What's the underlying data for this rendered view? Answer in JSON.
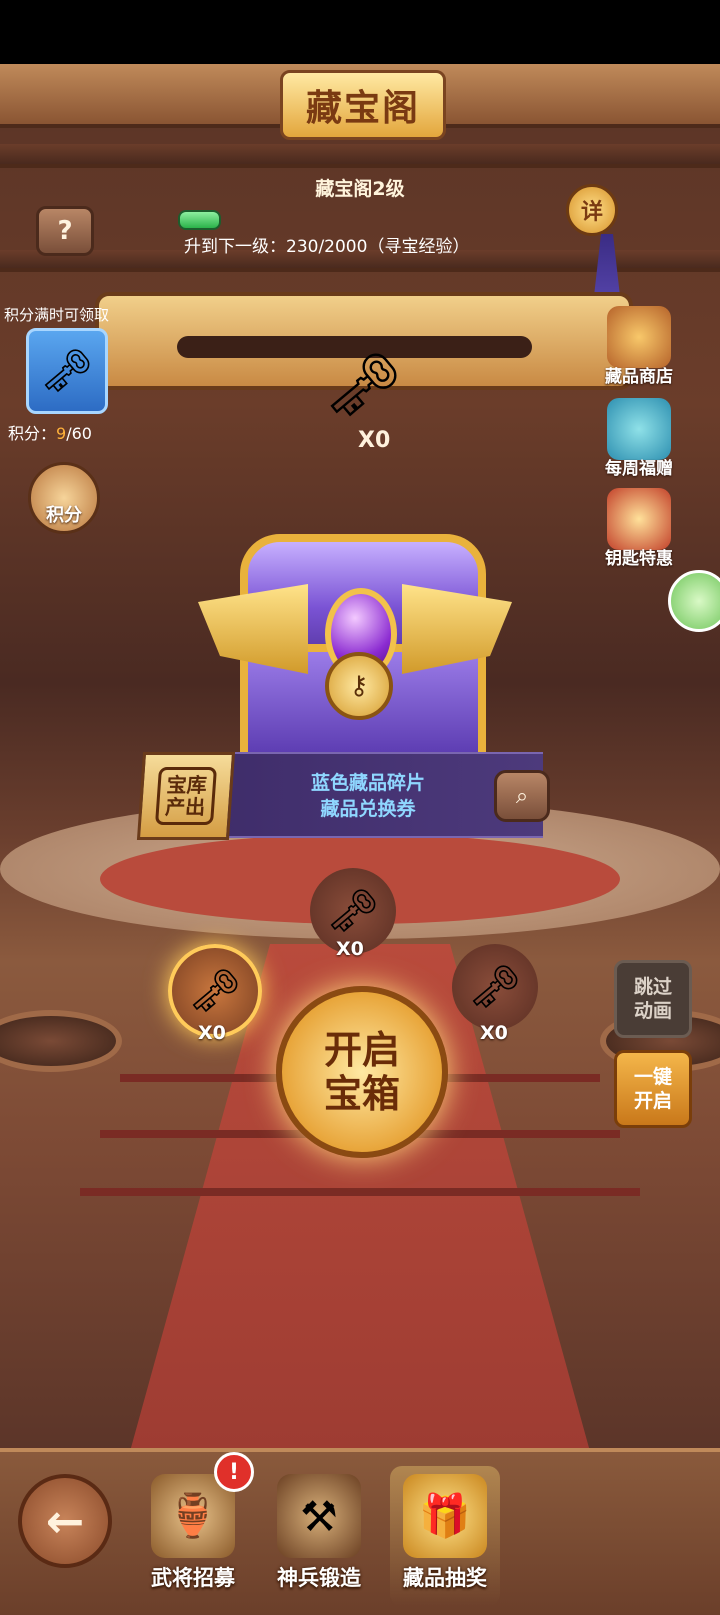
{
  "header": {
    "title": "藏宝阁",
    "level": "藏宝阁2级",
    "exp_progress": 0.115,
    "exp_text": "升到下一级：230/2000（寻宝经验）",
    "help_label": "?",
    "detail_label": "详"
  },
  "points": {
    "claim_hint": "积分满时可领取",
    "label": "积分：",
    "current": "9",
    "total": "/60",
    "button_label": "积分"
  },
  "side_menu": [
    {
      "label": "藏品商店",
      "icon": "shop-icon"
    },
    {
      "label": "每周福赠",
      "icon": "gift-icon"
    },
    {
      "label": "钥匙特惠",
      "icon": "present-icon"
    }
  ],
  "key_counter": "X0",
  "vault": {
    "badge": "宝库产出",
    "line1": "蓝色藏品碎片",
    "line2": "藏品兑换券"
  },
  "key_slots": [
    {
      "name": "bronze",
      "count": "X0",
      "selected": true
    },
    {
      "name": "silver",
      "count": "X0",
      "selected": false
    },
    {
      "name": "gold",
      "count": "X0",
      "selected": false
    }
  ],
  "open_button": "开启宝箱",
  "skip_button": "跳过动画",
  "one_key_button": "一键开启",
  "bottom_tabs": [
    {
      "label": "武将招募",
      "badge": "!"
    },
    {
      "label": "神兵锻造"
    },
    {
      "label": "藏品抽奖"
    }
  ],
  "colors": {
    "gold": "#e9b23c",
    "purple": "#7a53d4",
    "carpet": "#b94b3c",
    "accent_orange": "#ffb23b",
    "vault_text": "#8fd7ff"
  }
}
